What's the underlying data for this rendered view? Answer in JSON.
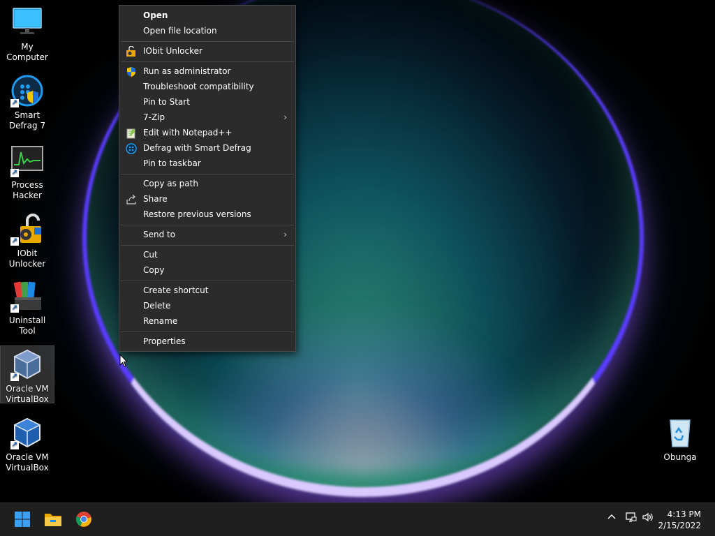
{
  "desktop": {
    "icons": [
      {
        "label": "My Computer",
        "icon": "monitor-icon"
      },
      {
        "label": "Smart Defrag 7",
        "icon": "smart-defrag-icon"
      },
      {
        "label": "Process Hacker",
        "icon": "process-hacker-icon"
      },
      {
        "label": "IObit Unlocker",
        "icon": "unlocker-icon"
      },
      {
        "label": "Uninstall Tool",
        "icon": "uninstall-tool-icon"
      },
      {
        "label": "Oracle VM VirtualBox",
        "icon": "virtualbox-icon"
      },
      {
        "label": "Oracle VM VirtualBox",
        "icon": "virtualbox-icon"
      }
    ],
    "recycle_bin": {
      "label": "Obunga",
      "icon": "recycle-bin-icon"
    }
  },
  "context_menu": {
    "items": [
      {
        "label": "Open",
        "bold": true
      },
      {
        "label": "Open file location"
      },
      {
        "label": "IObit Unlocker",
        "icon": "iobit-unlocker-icon"
      },
      {
        "label": "Run as administrator",
        "icon": "uac-shield-icon"
      },
      {
        "label": "Troubleshoot compatibility"
      },
      {
        "label": "Pin to Start"
      },
      {
        "label": "7-Zip",
        "submenu": true
      },
      {
        "label": "Edit with Notepad++",
        "icon": "notepad-plus-plus-icon"
      },
      {
        "label": "Defrag with Smart Defrag",
        "icon": "smart-defrag-small-icon"
      },
      {
        "label": "Pin to taskbar"
      },
      {
        "label": "Copy as path"
      },
      {
        "label": "Share",
        "icon": "share-icon"
      },
      {
        "label": "Restore previous versions"
      },
      {
        "label": "Send to",
        "submenu": true
      },
      {
        "label": "Cut"
      },
      {
        "label": "Copy"
      },
      {
        "label": "Create shortcut"
      },
      {
        "label": "Delete"
      },
      {
        "label": "Rename"
      },
      {
        "label": "Properties"
      }
    ],
    "submenu_glyph": "›"
  },
  "taskbar": {
    "pinned": [
      {
        "name": "start",
        "icon": "windows-start-icon"
      },
      {
        "name": "file-explorer",
        "icon": "folder-icon"
      },
      {
        "name": "chrome",
        "icon": "chrome-icon"
      }
    ],
    "tray": {
      "chevron": "^",
      "icons": [
        "network-icon",
        "volume-icon"
      ]
    },
    "clock": {
      "time": "4:13 PM",
      "date": "2/15/2022"
    }
  },
  "colors": {
    "menu_bg": "#2b2b2b",
    "menu_separator": "#484848",
    "taskbar_bg": "#1f1f1f",
    "accent": "#0078d4"
  }
}
